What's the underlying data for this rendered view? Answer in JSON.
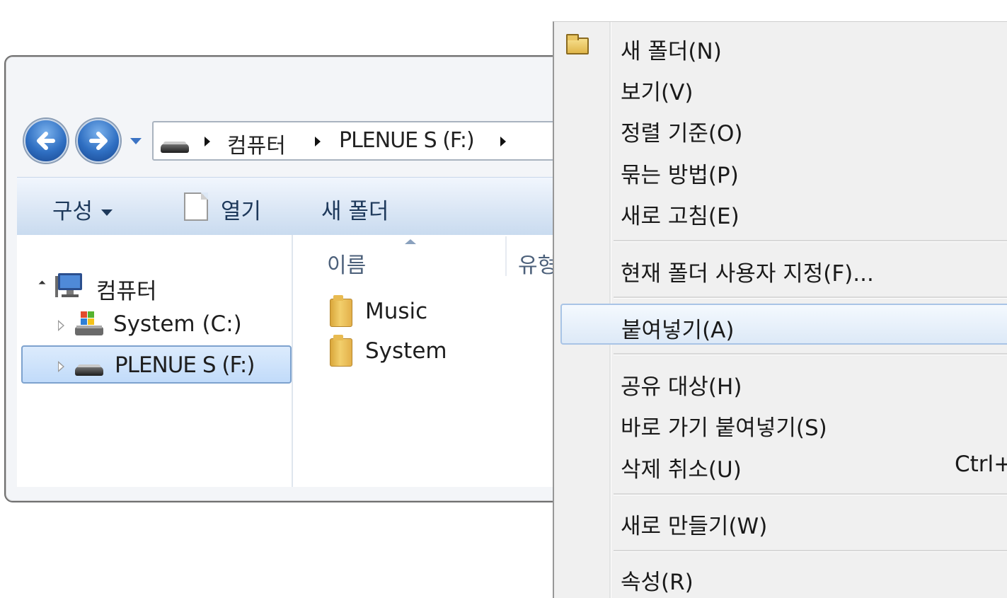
{
  "explorer": {
    "breadcrumb": [
      "컴퓨터",
      "PLENUE S  (F:)"
    ],
    "toolbar": {
      "organize": "구성",
      "open": "열기",
      "new_folder": "새 폴더"
    },
    "tree": [
      {
        "label": "컴퓨터",
        "icon": "computer-icon",
        "expanded": true
      },
      {
        "label": "System (C:)",
        "icon": "system-drive-icon"
      },
      {
        "label": "PLENUE S  (F:)",
        "icon": "removable-drive-icon",
        "selected": true
      }
    ],
    "columns": {
      "name": "이름",
      "type": "유형"
    },
    "files": [
      {
        "name": "Music",
        "icon": "folder-icon"
      },
      {
        "name": "System",
        "icon": "folder-icon"
      }
    ]
  },
  "context_menu": {
    "items": [
      {
        "label": "새 폴더(N)",
        "icon": "new-folder-icon"
      },
      {
        "label": "보기(V)"
      },
      {
        "label": "정렬 기준(O)"
      },
      {
        "label": "묶는 방법(P)"
      },
      {
        "label": "새로 고침(E)"
      },
      {
        "label": "현재 폴더 사용자 지정(F)..."
      },
      {
        "label": "붙여넣기(A)",
        "highlighted": true
      },
      {
        "label": "공유 대상(H)"
      },
      {
        "label": "바로 가기 붙여넣기(S)"
      },
      {
        "label": "삭제 취소(U)",
        "shortcut": "Ctrl+Z"
      },
      {
        "label": "새로 만들기(W)"
      },
      {
        "label": "속성(R)"
      }
    ]
  },
  "colors": {
    "accent": "#3b73c4",
    "selection_border": "#7da2ce",
    "menu_bg": "#f0f0f0"
  }
}
